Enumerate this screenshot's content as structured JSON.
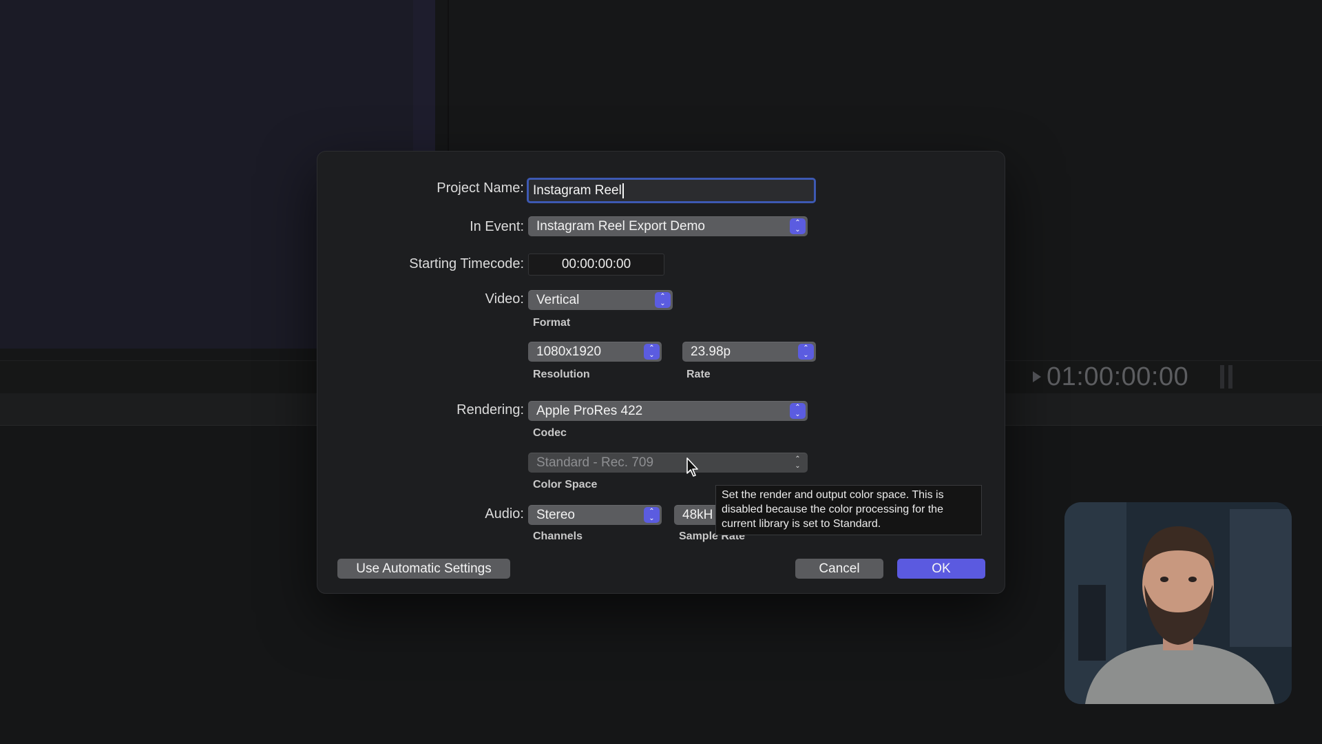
{
  "background": {
    "timecode": "01:00:00:00"
  },
  "dialog": {
    "project_name": {
      "label": "Project Name:",
      "value": "Instagram Reel"
    },
    "in_event": {
      "label": "In Event:",
      "value": "Instagram Reel Export Demo"
    },
    "starting_timecode": {
      "label": "Starting Timecode:",
      "value": "00:00:00:00"
    },
    "video": {
      "label": "Video:",
      "format": {
        "value": "Vertical",
        "caption": "Format"
      },
      "resolution": {
        "value": "1080x1920",
        "caption": "Resolution"
      },
      "rate": {
        "value": "23.98p",
        "caption": "Rate"
      }
    },
    "rendering": {
      "label": "Rendering:",
      "codec": {
        "value": "Apple ProRes 422",
        "caption": "Codec"
      },
      "color_space": {
        "value": "Standard - Rec. 709",
        "caption": "Color Space",
        "disabled": true
      }
    },
    "audio": {
      "label": "Audio:",
      "channels": {
        "value": "Stereo",
        "caption": "Channels"
      },
      "sample_rate": {
        "value": "48kH",
        "caption": "Sample Rate"
      }
    },
    "tooltip": "Set the render and output color space. This is disabled because the color processing for the current library is set to Standard.",
    "buttons": {
      "automatic": "Use Automatic Settings",
      "cancel": "Cancel",
      "ok": "OK"
    }
  },
  "colors": {
    "accent": "#5b5ae0",
    "focus_ring": "#3d59b3",
    "dialog_bg": "#1d1e20",
    "popup_bg": "#5b5c5f"
  }
}
